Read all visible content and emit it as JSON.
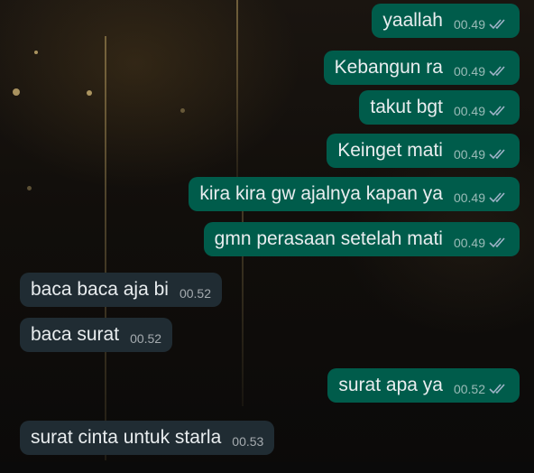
{
  "messages": [
    {
      "text": "yaallah",
      "time": "00.49",
      "direction": "out",
      "status_icon": "double-check-icon"
    },
    {
      "text": "Kebangun ra",
      "time": "00.49",
      "direction": "out",
      "status_icon": "double-check-icon"
    },
    {
      "text": "takut bgt",
      "time": "00.49",
      "direction": "out",
      "status_icon": "double-check-icon"
    },
    {
      "text": "Keinget mati",
      "time": "00.49",
      "direction": "out",
      "status_icon": "double-check-icon"
    },
    {
      "text": "kira kira gw ajalnya kapan ya",
      "time": "00.49",
      "direction": "out",
      "status_icon": "double-check-icon"
    },
    {
      "text": "gmn perasaan setelah mati",
      "time": "00.49",
      "direction": "out",
      "status_icon": "double-check-icon"
    },
    {
      "text": "baca baca aja bi",
      "time": "00.52",
      "direction": "in"
    },
    {
      "text": "baca surat",
      "time": "00.52",
      "direction": "in"
    },
    {
      "text": "surat apa ya",
      "time": "00.52",
      "direction": "out",
      "status_icon": "double-check-icon"
    },
    {
      "text": "surat cinta untuk starla",
      "time": "00.53",
      "direction": "in"
    }
  ],
  "colors": {
    "outgoing_bubble": "#005c4b",
    "incoming_bubble": "#202c33",
    "tick": "#9fb3c8"
  }
}
